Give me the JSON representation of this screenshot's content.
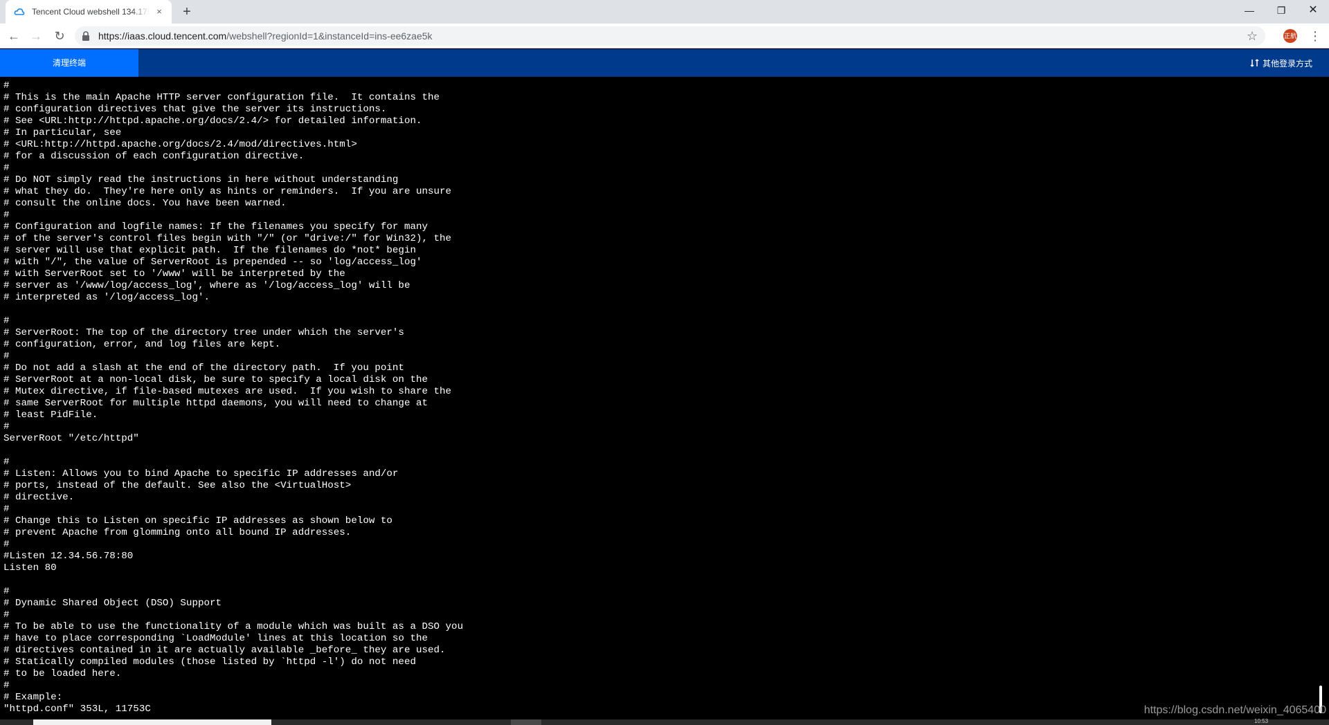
{
  "browser": {
    "tab_title": "Tencent Cloud webshell 134.175.",
    "tab_close": "×",
    "new_tab": "+",
    "url_host": "https://iaas.cloud.tencent.com",
    "url_rest": "/webshell?regionId=1&instanceId=ins-ee6zae5k",
    "profile_initials": "正航",
    "window": {
      "minimize": "—",
      "maximize": "❐",
      "close": "✕"
    }
  },
  "appbar": {
    "clear_button": "清理终端",
    "other_login": "其他登录方式"
  },
  "terminal": {
    "lines": [
      "#",
      "# This is the main Apache HTTP server configuration file.  It contains the",
      "# configuration directives that give the server its instructions.",
      "# See <URL:http://httpd.apache.org/docs/2.4/> for detailed information.",
      "# In particular, see",
      "# <URL:http://httpd.apache.org/docs/2.4/mod/directives.html>",
      "# for a discussion of each configuration directive.",
      "#",
      "# Do NOT simply read the instructions in here without understanding",
      "# what they do.  They're here only as hints or reminders.  If you are unsure",
      "# consult the online docs. You have been warned.",
      "#",
      "# Configuration and logfile names: If the filenames you specify for many",
      "# of the server's control files begin with \"/\" (or \"drive:/\" for Win32), the",
      "# server will use that explicit path.  If the filenames do *not* begin",
      "# with \"/\", the value of ServerRoot is prepended -- so 'log/access_log'",
      "# with ServerRoot set to '/www' will be interpreted by the",
      "# server as '/www/log/access_log', where as '/log/access_log' will be",
      "# interpreted as '/log/access_log'.",
      "",
      "#",
      "# ServerRoot: The top of the directory tree under which the server's",
      "# configuration, error, and log files are kept.",
      "#",
      "# Do not add a slash at the end of the directory path.  If you point",
      "# ServerRoot at a non-local disk, be sure to specify a local disk on the",
      "# Mutex directive, if file-based mutexes are used.  If you wish to share the",
      "# same ServerRoot for multiple httpd daemons, you will need to change at",
      "# least PidFile.",
      "#",
      "ServerRoot \"/etc/httpd\"",
      "",
      "#",
      "# Listen: Allows you to bind Apache to specific IP addresses and/or",
      "# ports, instead of the default. See also the <VirtualHost>",
      "# directive.",
      "#",
      "# Change this to Listen on specific IP addresses as shown below to",
      "# prevent Apache from glomming onto all bound IP addresses.",
      "#",
      "#Listen 12.34.56.78:80",
      "Listen 80",
      "",
      "#",
      "# Dynamic Shared Object (DSO) Support",
      "#",
      "# To be able to use the functionality of a module which was built as a DSO you",
      "# have to place corresponding `LoadModule' lines at this location so the",
      "# directives contained in it are actually available _before_ they are used.",
      "# Statically compiled modules (those listed by `httpd -l') do not need",
      "# to be loaded here.",
      "#",
      "# Example:",
      "\"httpd.conf\" 353L, 11753C"
    ]
  },
  "watermark": "https://blog.csdn.net/weixin_4065400",
  "taskbar_clock": "10:53",
  "colors": {
    "appbar_bg": "#003a8c",
    "clear_button_bg": "#006eff",
    "terminal_bg": "#000000",
    "terminal_fg": "#ffffff"
  },
  "icons": [
    "cloud-favicon-icon",
    "lock-icon",
    "star-icon",
    "menu-icon",
    "switch-login-icon",
    "back-arrow-icon",
    "forward-arrow-icon",
    "reload-icon"
  ]
}
